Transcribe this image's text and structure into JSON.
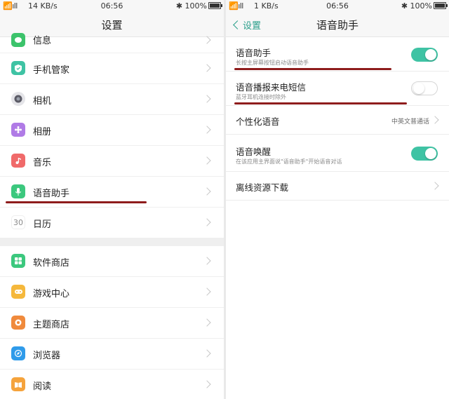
{
  "left": {
    "status": {
      "signal": "📶ıll",
      "speed": "14 KB/s",
      "time": "06:56",
      "right": "✱ 100%"
    },
    "nav_title": "设置",
    "group1": [
      {
        "label": "信息",
        "icon": "message-icon",
        "color": "#3cc36b"
      },
      {
        "label": "手机管家",
        "icon": "shield-icon",
        "color": "#3fc3a4"
      },
      {
        "label": "相机",
        "icon": "camera-icon",
        "color": "#5b5b66"
      },
      {
        "label": "相册",
        "icon": "gallery-icon",
        "color": "#b07be6"
      },
      {
        "label": "音乐",
        "icon": "music-icon",
        "color": "#f06a6a"
      },
      {
        "label": "语音助手",
        "icon": "mic-icon",
        "color": "#3cc87e"
      },
      {
        "label": "日历",
        "icon": "calendar-icon",
        "color": "#ffffff",
        "icon_text": "30"
      }
    ],
    "group2": [
      {
        "label": "软件商店",
        "icon": "store-icon",
        "color": "#3cc87e"
      },
      {
        "label": "游戏中心",
        "icon": "game-icon",
        "color": "#f5b83c"
      },
      {
        "label": "主题商店",
        "icon": "theme-icon",
        "color": "#f08a3c"
      },
      {
        "label": "浏览器",
        "icon": "browser-icon",
        "color": "#2f9bea"
      },
      {
        "label": "阅读",
        "icon": "book-icon",
        "color": "#f5a33c"
      }
    ]
  },
  "right": {
    "status": {
      "signal": "📶ıll",
      "speed": "1 KB/s",
      "time": "06:56",
      "right": "✱ 100%"
    },
    "back_label": "设置",
    "nav_title": "语音助手",
    "items": {
      "voice_assistant": {
        "title": "语音助手",
        "sub": "长按主屏幕按钮启动语音助手",
        "toggle": "on"
      },
      "read_sms": {
        "title": "语音播报来电短信",
        "sub": "蓝牙耳机连接时除外",
        "toggle": "off"
      },
      "personal_voice": {
        "title": "个性化语音",
        "value": "中英文普通话"
      },
      "voice_wake": {
        "title": "语音唤醒",
        "sub": "在该应用主界面说\"语音助手\"开始语音对话",
        "toggle": "on"
      },
      "offline_download": {
        "title": "离线资源下载"
      }
    }
  },
  "accent_color": "#3fc3a4",
  "annotation_color": "#8e1c1c"
}
